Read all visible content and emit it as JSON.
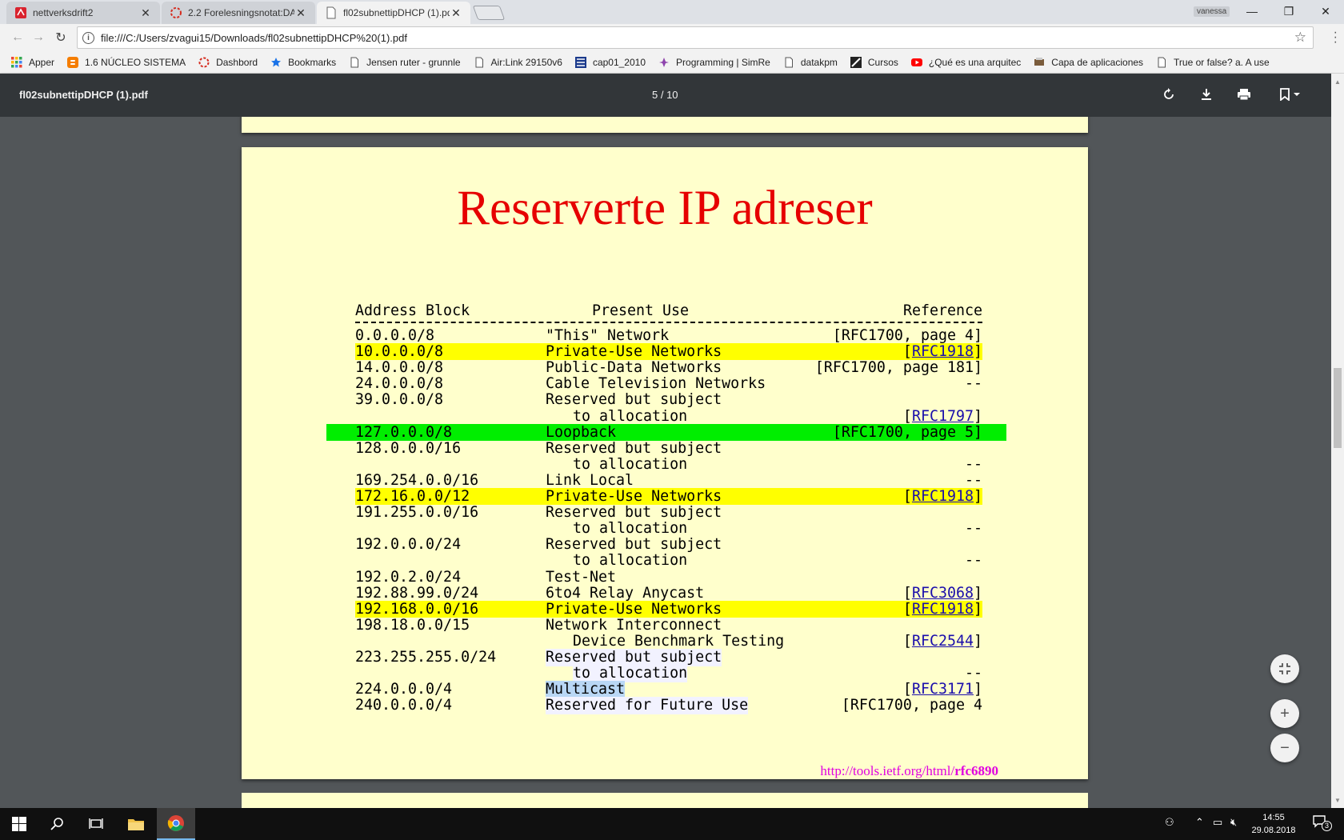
{
  "tabs": [
    {
      "title": "nettverksdrift2",
      "active": false,
      "favicon": "pdf-red-icon"
    },
    {
      "title": "2.2 Forelesningsnotat:DA",
      "active": false,
      "favicon": "loading-spinner-icon"
    },
    {
      "title": "fl02subnettipDHCP (1).pd",
      "active": true,
      "favicon": "document-icon"
    }
  ],
  "user_chip": "vanessa",
  "address_bar": {
    "url": "file:///C:/Users/zvagui15/Downloads/fl02subnettipDHCP%20(1).pdf"
  },
  "bookmarks": [
    {
      "label": "Apper",
      "icon": "apps-grid-icon"
    },
    {
      "label": "1.6 NÚCLEO SISTEMA",
      "icon": "blogger-icon"
    },
    {
      "label": "Dashbord",
      "icon": "spinner-icon"
    },
    {
      "label": "Bookmarks",
      "icon": "star-icon"
    },
    {
      "label": "Jensen ruter - grunnle",
      "icon": "page-icon"
    },
    {
      "label": "Air:Link 29150v6",
      "icon": "page-icon"
    },
    {
      "label": "cap01_2010",
      "icon": "flag-icon"
    },
    {
      "label": "Programming | SimRe",
      "icon": "simreal-icon"
    },
    {
      "label": "datakpm",
      "icon": "page-icon"
    },
    {
      "label": "Cursos",
      "icon": "cursos-icon"
    },
    {
      "label": "¿Qué es una arquitec",
      "icon": "youtube-icon"
    },
    {
      "label": "Capa de aplicaciones",
      "icon": "printer-site-icon"
    },
    {
      "label": "True or false? a. A use",
      "icon": "page-icon"
    }
  ],
  "pdf": {
    "filename": "fl02subnettipDHCP (1).pdf",
    "page_indicator": "5  /  10"
  },
  "slide": {
    "title": "Reserverte IP adreser",
    "headers": {
      "address": "Address Block",
      "use": "Present Use",
      "ref": "Reference"
    },
    "rows": [
      {
        "addr": "0.0.0.0/8",
        "use": "\"This\" Network",
        "ref": "[RFC1700, page 4]"
      },
      {
        "addr": "10.0.0.0/8",
        "use": "Private-Use Networks",
        "ref_link": "RFC1918",
        "highlight": "yellow"
      },
      {
        "addr": "14.0.0.0/8",
        "use": "Public-Data Networks",
        "ref": "[RFC1700, page 181]"
      },
      {
        "addr": "24.0.0.0/8",
        "use": "Cable Television Networks",
        "ref": "--"
      },
      {
        "addr": "39.0.0.0/8",
        "use": "Reserved but subject"
      },
      {
        "use2": "to allocation",
        "ref_link": "RFC1797"
      },
      {
        "addr": "127.0.0.0/8",
        "use": "Loopback",
        "ref": "[RFC1700, page 5]",
        "highlight": "green"
      },
      {
        "addr": "128.0.0.0/16",
        "use": "Reserved but subject"
      },
      {
        "use2": "to allocation",
        "ref": "--"
      },
      {
        "addr": "169.254.0.0/16",
        "use": "Link Local",
        "ref": "--"
      },
      {
        "addr": "172.16.0.0/12",
        "use": "Private-Use Networks",
        "ref_link": "RFC1918",
        "highlight": "yellow"
      },
      {
        "addr": "191.255.0.0/16",
        "use": "Reserved but subject"
      },
      {
        "use2": "to allocation",
        "ref": "--"
      },
      {
        "addr": "192.0.0.0/24",
        "use": "Reserved but subject"
      },
      {
        "use2": "to allocation",
        "ref": "--"
      },
      {
        "addr": "192.0.2.0/24",
        "use": "Test-Net"
      },
      {
        "addr": "192.88.99.0/24",
        "use": "6to4 Relay Anycast",
        "ref_link": "RFC3068"
      },
      {
        "addr": "192.168.0.0/16",
        "use": "Private-Use Networks",
        "ref_link": "RFC1918",
        "highlight": "yellow"
      },
      {
        "addr": "198.18.0.0/15",
        "use": "Network Interconnect"
      },
      {
        "use2": "Device Benchmark Testing",
        "ref_link": "RFC2544"
      },
      {
        "addr": "223.255.255.0/24",
        "use": "Reserved but subject",
        "selected": true
      },
      {
        "use2": "to allocation",
        "ref": "--",
        "selected": true
      },
      {
        "addr": "224.0.0.0/4",
        "use": "Multicast",
        "ref_link": "RFC3171",
        "selected_strong": true
      },
      {
        "addr": "240.0.0.0/4",
        "use": "Reserved for Future Use",
        "ref": "[RFC1700, page 4",
        "selected": true
      }
    ],
    "source_prefix": "http://tools.ietf.org/html/",
    "source_bold": "rfc6890"
  },
  "taskbar": {
    "time": "14:55",
    "date": "29.08.2018",
    "notification_count": "3"
  },
  "colors": {
    "page_bg": "#ffffcc",
    "title_red": "#e60000",
    "highlight_yellow": "#ffff00",
    "highlight_green": "#00ee00",
    "link_blue": "#1a0dab",
    "source_magenta": "#e000e0"
  }
}
